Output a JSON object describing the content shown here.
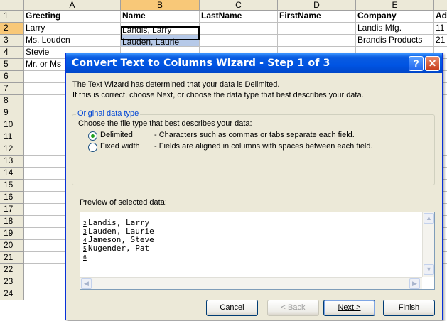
{
  "spreadsheet": {
    "columns": [
      {
        "label": "A"
      },
      {
        "label": "B"
      },
      {
        "label": "C"
      },
      {
        "label": "D"
      },
      {
        "label": "E"
      }
    ],
    "rows": [
      "1",
      "2",
      "3",
      "4",
      "5",
      "6",
      "7",
      "8",
      "9",
      "10",
      "11",
      "12",
      "13",
      "14",
      "15",
      "16",
      "17",
      "18",
      "19",
      "20",
      "21",
      "22",
      "23",
      "24"
    ],
    "row1": {
      "a": "Greeting",
      "b": "Name",
      "c": "LastName",
      "d": "FirstName",
      "e": "Company",
      "f": "Ad"
    },
    "row2": {
      "a": "Larry",
      "b": "Landis, Larry",
      "e": "Landis Mfg.",
      "f": "11"
    },
    "row3": {
      "a": "Ms. Louden",
      "b": "Lauden, Laurie",
      "e": "Brandis Products",
      "f": "21"
    },
    "row4": {
      "a": "Stevie"
    },
    "row5": {
      "a": "Mr. or Ms"
    }
  },
  "dialog": {
    "title": "Convert Text to Columns Wizard - Step 1 of 3",
    "help_icon": "question-mark",
    "close_icon": "x-close",
    "intro_line1": "The Text Wizard has determined that your data is Delimited.",
    "intro_line2": "If this is correct, choose Next, or choose the data type that best describes your data.",
    "group_label": "Original data type",
    "choose_label": "Choose the file type that best describes your data:",
    "options": [
      {
        "label": "Delimited",
        "description": "- Characters such as commas or tabs separate each field.",
        "selected": true
      },
      {
        "label": "Fixed width",
        "description": "- Fields are aligned in columns with spaces between each field.",
        "selected": false
      }
    ],
    "preview_label": "Preview of selected data:",
    "preview_rows": [
      {
        "num": "2",
        "text": "Landis, Larry"
      },
      {
        "num": "3",
        "text": "Lauden, Laurie"
      },
      {
        "num": "4",
        "text": "Jameson, Steve"
      },
      {
        "num": "5",
        "text": "Nugender, Pat"
      },
      {
        "num": "6",
        "text": ""
      }
    ],
    "buttons": {
      "cancel": "Cancel",
      "back": "< Back",
      "next": "Next >",
      "finish": "Finish"
    }
  },
  "colors": {
    "selection_header": "#f8c878",
    "title_bar": "#0054e3",
    "highlight": "#b6c9e8"
  }
}
